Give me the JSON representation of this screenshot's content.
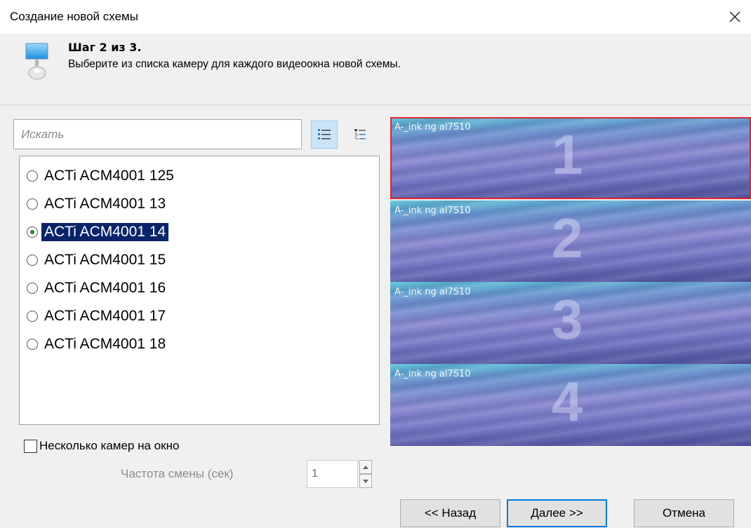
{
  "window": {
    "title": "Создание новой схемы"
  },
  "header": {
    "step_title": "Шаг 2 из 3.",
    "step_description": "Выберите из списка камеру для каждого видеоокна новой схемы."
  },
  "search": {
    "placeholder": "Искать",
    "value": ""
  },
  "camera_list": {
    "items": [
      {
        "label": "ACTi ACM4001 125",
        "selected": false
      },
      {
        "label": "ACTi ACM4001 13",
        "selected": false
      },
      {
        "label": "ACTi ACM4001 14",
        "selected": true
      },
      {
        "label": "ACTi ACM4001 15",
        "selected": false
      },
      {
        "label": "ACTi ACM4001 16",
        "selected": false
      },
      {
        "label": "ACTi ACM4001 17",
        "selected": false
      },
      {
        "label": "ACTi ACM4001 18",
        "selected": false
      }
    ]
  },
  "options": {
    "multi_camera_label": "Несколько камер на окно",
    "multi_camera_checked": false,
    "frequency_label": "Частота смены (сек)",
    "frequency_value": "1"
  },
  "preview": {
    "tiles": [
      {
        "caption": "A-_ink ng al7S10",
        "number": "1",
        "active": true
      },
      {
        "caption": "A-_ink ng al7S10",
        "number": "2",
        "active": false
      },
      {
        "caption": "A-_ink ng al7S10",
        "number": "3",
        "active": false
      },
      {
        "caption": "A-_ink ng al7S10",
        "number": "4",
        "active": false
      }
    ]
  },
  "buttons": {
    "back": "<< Назад",
    "next": "Далее >>",
    "cancel": "Отмена"
  },
  "colors": {
    "selection_bg": "#0a246a",
    "active_tile_border": "#e0242e",
    "default_button_border": "#0078d7"
  },
  "icons": {
    "close": "close-icon",
    "wizard": "monitor-icon",
    "list_view": "list-view-icon",
    "tree_view": "tree-view-icon"
  }
}
